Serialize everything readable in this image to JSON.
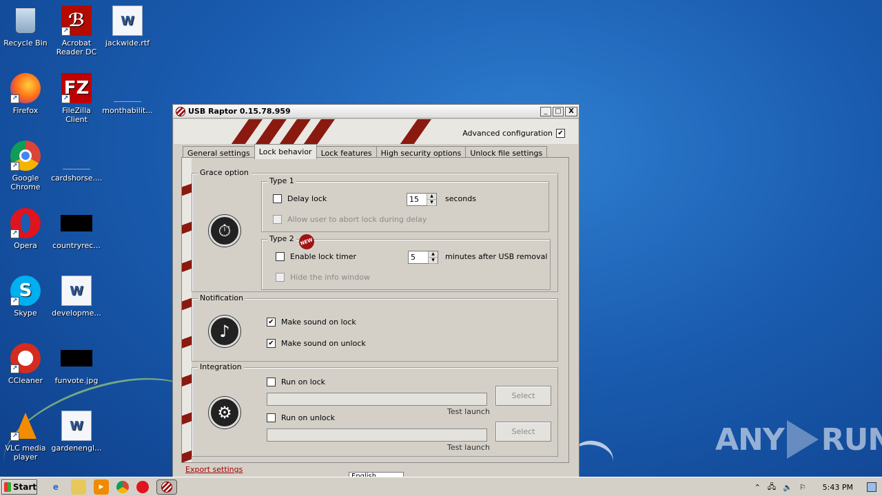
{
  "desktop": {
    "icons": [
      {
        "label": "Recycle Bin",
        "icon": "recycle-bin-icon"
      },
      {
        "label": "Acrobat Reader DC",
        "icon": "acrobat-icon"
      },
      {
        "label": "jackwide.rtf",
        "icon": "word-doc-icon"
      },
      {
        "label": "Firefox",
        "icon": "firefox-icon"
      },
      {
        "label": "FileZilla Client",
        "icon": "filezilla-icon"
      },
      {
        "label": "monthabilit...",
        "icon": "blank-file-icon"
      },
      {
        "label": "Google Chrome",
        "icon": "chrome-icon"
      },
      {
        "label": "cardshorse....",
        "icon": "blank-file-icon"
      },
      {
        "label": "Opera",
        "icon": "opera-icon"
      },
      {
        "label": "countryrec...",
        "icon": "black-thumbnail-icon"
      },
      {
        "label": "Skype",
        "icon": "skype-icon"
      },
      {
        "label": "developme...",
        "icon": "word-doc-icon"
      },
      {
        "label": "CCleaner",
        "icon": "ccleaner-icon"
      },
      {
        "label": "funvote.jpg",
        "icon": "black-thumbnail-icon"
      },
      {
        "label": "VLC media player",
        "icon": "vlc-icon"
      },
      {
        "label": "gardenengl...",
        "icon": "word-doc-icon"
      }
    ]
  },
  "window": {
    "title": "USB Raptor 0.15.78.959",
    "controls": {
      "minimize": "_",
      "maximize": "□",
      "close": "X"
    },
    "advanced_config": {
      "label": "Advanced configuration",
      "checked": true
    },
    "tabs": [
      {
        "label": "General settings",
        "active": false
      },
      {
        "label": "Lock behavior",
        "active": true
      },
      {
        "label": "Lock features",
        "active": false
      },
      {
        "label": "High security options",
        "active": false
      },
      {
        "label": "Unlock file settings",
        "active": false
      }
    ],
    "grace": {
      "label": "Grace option",
      "type1": {
        "label": "Type 1",
        "delay_lock": {
          "label": "Delay lock",
          "checked": false
        },
        "seconds_value": "15",
        "seconds_label": "seconds",
        "allow_abort": {
          "label": "Allow user to abort lock during delay",
          "checked": false,
          "enabled": false
        }
      },
      "type2": {
        "label": "Type 2",
        "new_badge": "NEW",
        "enable_timer": {
          "label": "Enable lock timer",
          "checked": false
        },
        "minutes_value": "5",
        "minutes_label": "minutes after USB removal",
        "hide_info": {
          "label": "Hide the info window",
          "checked": false,
          "enabled": false
        }
      }
    },
    "notification": {
      "label": "Notification",
      "sound_lock": {
        "label": "Make sound on lock",
        "checked": true
      },
      "sound_unlock": {
        "label": "Make sound on unlock",
        "checked": true
      }
    },
    "integration": {
      "label": "Integration",
      "run_on_lock": {
        "label": "Run on lock",
        "checked": false
      },
      "run_on_unlock": {
        "label": "Run on unlock",
        "checked": false
      },
      "select_label": "Select",
      "test_launch": "Test launch"
    },
    "export_link": "Export settings",
    "language_value": "English"
  },
  "taskbar": {
    "start_label": "Start",
    "clock": "5:43 PM"
  },
  "watermark": {
    "left": "ANY",
    "right": "RUN"
  }
}
